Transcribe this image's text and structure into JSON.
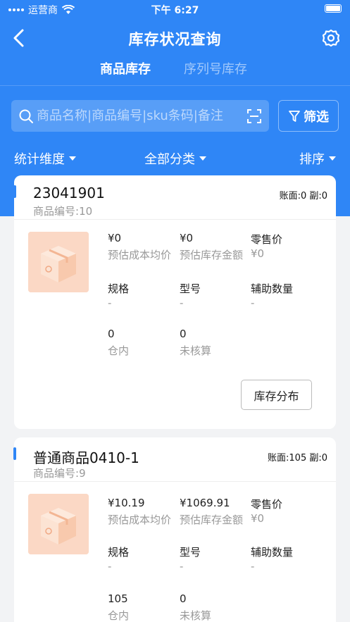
{
  "status_bar": {
    "carrier": "运营商",
    "time": "下午 6:27"
  },
  "nav": {
    "title": "库存状况查询"
  },
  "tabs": [
    {
      "label": "商品库存",
      "active": true
    },
    {
      "label": "序列号库存",
      "active": false
    }
  ],
  "search": {
    "placeholder": "商品名称|商品编号|sku条码|备注"
  },
  "filter": {
    "label": "筛选"
  },
  "dimensions": {
    "stats": "统计维度",
    "category": "全部分类",
    "sort": "排序"
  },
  "colors": {
    "primary": "#2f86f6",
    "thumb_bg": "#fbd8c5"
  },
  "field_labels": {
    "avg_cost": "预估成本均价",
    "stock_amount": "预估库存金额",
    "retail_price": "零售价",
    "spec": "规格",
    "model": "型号",
    "aux_qty": "辅助数量",
    "in_warehouse": "仓内",
    "unaccounted": "未核算"
  },
  "distribution_label": "库存分布",
  "products": [
    {
      "name": "23041901",
      "ledger": "账面:0 副:0",
      "code_label": "商品编号:",
      "code": "10",
      "avg_cost": "¥0",
      "stock_amount": "¥0",
      "retail_price": "¥0",
      "spec": "-",
      "model": "-",
      "aux_qty": "-",
      "in_warehouse": "0",
      "unaccounted": "0"
    },
    {
      "name": "普通商品0410-1",
      "ledger": "账面:105 副:0",
      "code_label": "商品编号:",
      "code": "9",
      "avg_cost": "¥10.19",
      "stock_amount": "¥1069.91",
      "retail_price": "¥0",
      "spec": "-",
      "model": "-",
      "aux_qty": "-",
      "in_warehouse": "105",
      "unaccounted": "0"
    }
  ]
}
